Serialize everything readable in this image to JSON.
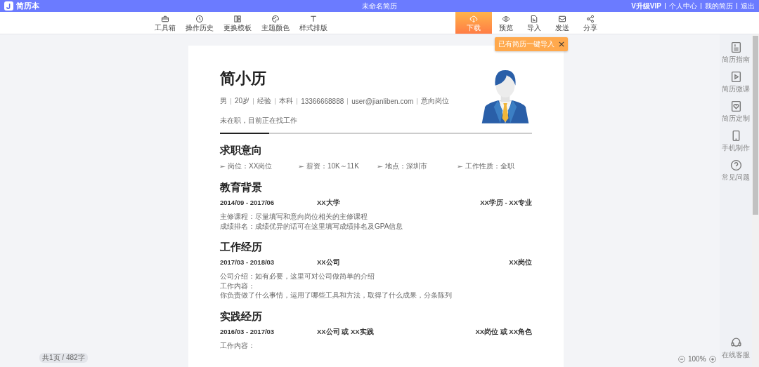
{
  "header": {
    "logo_text": "简历本",
    "title": "未命名简历",
    "links": [
      {
        "label": "V升级VIP",
        "kind": "vip"
      },
      {
        "label": "个人中心",
        "kind": "link"
      },
      {
        "label": "我的简历",
        "kind": "link"
      },
      {
        "label": "退出",
        "kind": "link"
      }
    ]
  },
  "toolbar": {
    "tools": [
      {
        "label": "工具箱"
      },
      {
        "label": "操作历史"
      },
      {
        "label": "更换模板"
      },
      {
        "label": "主题颜色"
      },
      {
        "label": "样式排版"
      }
    ],
    "actions": [
      {
        "label": "下载",
        "selected": true
      },
      {
        "label": "预览",
        "selected": false
      },
      {
        "label": "导入",
        "selected": false
      },
      {
        "label": "发送",
        "selected": false
      },
      {
        "label": "分享",
        "selected": false
      }
    ]
  },
  "tooltip": {
    "text": "已有简历一键导入"
  },
  "side_tools": [
    {
      "label": "简历指南"
    },
    {
      "label": "简历微课"
    },
    {
      "label": "简历定制"
    },
    {
      "label": "手机制作"
    },
    {
      "label": "常见问题"
    }
  ],
  "support": {
    "label": "在线客服"
  },
  "resume": {
    "name": "简小历",
    "info": [
      "男",
      "20岁",
      "经验",
      "本科",
      "13366668888",
      "user@jianliben.com",
      "意向岗位"
    ],
    "status": "未在职，目前正在找工作",
    "sections": [
      {
        "title": "求职意向",
        "kind": "intent",
        "items": [
          "岗位：XX岗位",
          "薪资：10K～11K",
          "地点：深圳市",
          "工作性质：全职"
        ]
      },
      {
        "title": "教育背景",
        "kind": "entries",
        "entries": [
          {
            "date": "2014/09 - 2017/06",
            "org": "XX大学",
            "role": "XX学历 - XX专业",
            "lines": [
              "主修课程：尽量填写和意向岗位相关的主修课程",
              "成绩排名：成绩优异的话可在这里填写成绩排名及GPA信息"
            ]
          }
        ]
      },
      {
        "title": "工作经历",
        "kind": "entries",
        "entries": [
          {
            "date": "2017/03 - 2018/03",
            "org": "XX公司",
            "role": "XX岗位",
            "lines": [
              "公司介绍：如有必要，这里可对公司做简单的介绍",
              "工作内容：",
              "你负责做了什么事情，运用了哪些工具和方法，取得了什么成果，分条陈列"
            ]
          }
        ]
      },
      {
        "title": "实践经历",
        "kind": "entries",
        "entries": [
          {
            "date": "2016/03 - 2017/03",
            "org": "XX公司 或 XX实践",
            "role": "XX岗位 或 XX角色",
            "lines": [
              "工作内容："
            ]
          }
        ]
      }
    ]
  },
  "footer": {
    "page_count": "共1页 / 482字",
    "zoom": "100%"
  }
}
